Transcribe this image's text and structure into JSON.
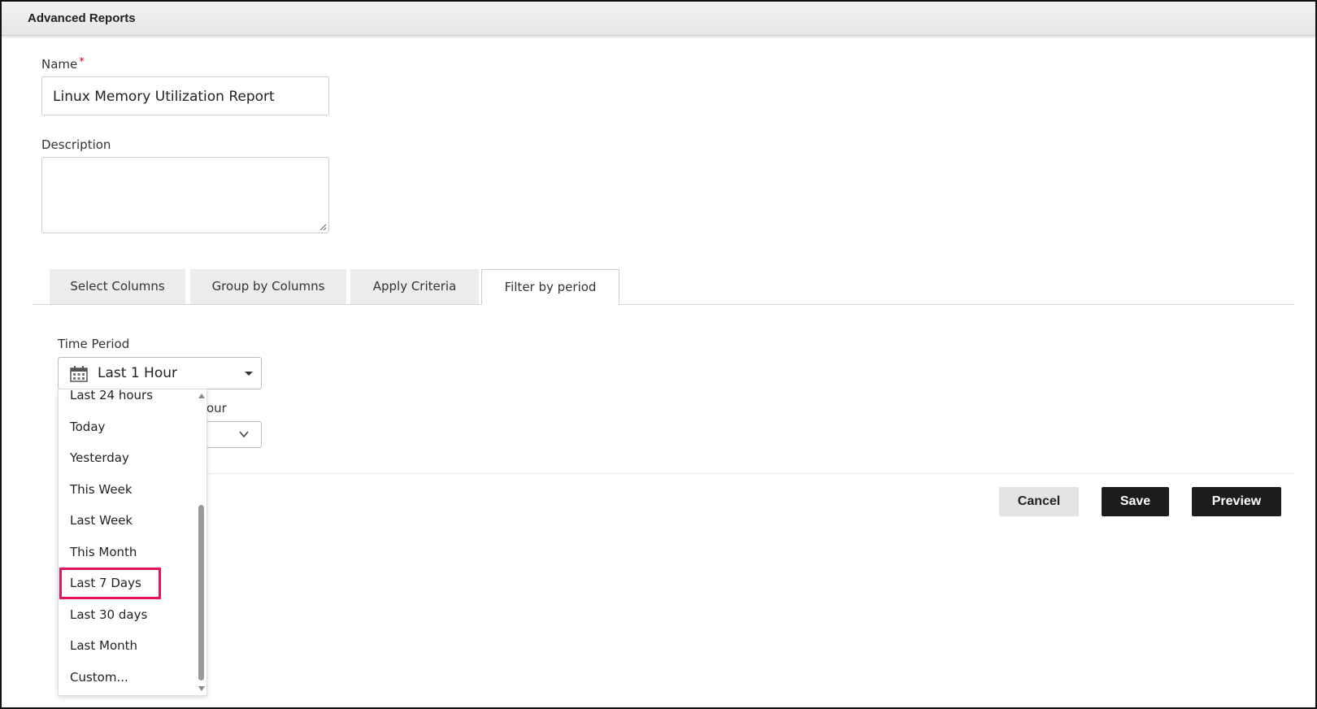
{
  "window": {
    "title": "Advanced Reports"
  },
  "form": {
    "name_label": "Name",
    "name_required": "*",
    "name_value": "Linux Memory Utilization Report",
    "description_label": "Description",
    "description_value": ""
  },
  "tabs": [
    {
      "label": "Select Columns",
      "active": false
    },
    {
      "label": "Group by Columns",
      "active": false
    },
    {
      "label": "Apply Criteria",
      "active": false
    },
    {
      "label": "Filter by period",
      "active": true
    }
  ],
  "filter": {
    "time_period_label": "Time Period",
    "time_period_value": "Last 1 Hour",
    "hour_label_partial": "our",
    "options": [
      "Last 24 hours",
      "Today",
      "Yesterday",
      "This Week",
      "Last Week",
      "This Month",
      "Last 7 Days",
      "Last 30 days",
      "Last Month",
      "Custom..."
    ],
    "highlighted_option": "Last 7 Days"
  },
  "buttons": {
    "cancel": "Cancel",
    "save": "Save",
    "preview": "Preview"
  },
  "colors": {
    "highlight_outline": "#e8125c",
    "primary_button": "#1c1c1c",
    "secondary_button": "#e3e3e3",
    "required_mark": "#d0021b"
  },
  "icons": {
    "time_period": "calendar-icon",
    "dropdown": "caret-down-icon",
    "hour_select": "chevron-down-icon"
  }
}
